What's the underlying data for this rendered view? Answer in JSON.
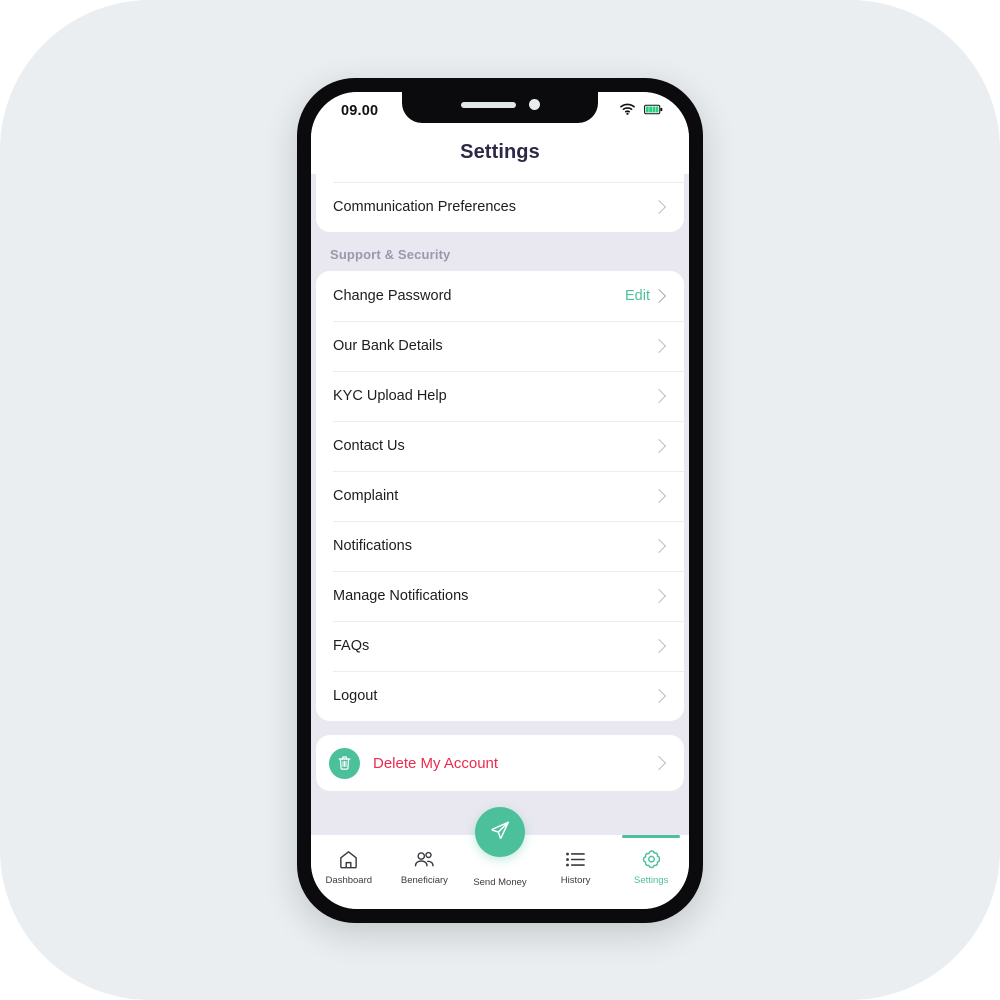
{
  "status_bar": {
    "time": "09.00",
    "wifi_icon": "wifi-icon",
    "battery_icon": "battery-icon"
  },
  "header": {
    "title": "Settings"
  },
  "colors": {
    "accent_green": "#4cbf9b",
    "danger_red": "#ec2b4e",
    "title_purple": "#2e2747",
    "screen_bg": "#e9e8f0",
    "backdrop": "#eaeef0"
  },
  "top_card": {
    "partial_row_label": "",
    "items": [
      {
        "label": "Communication Preferences",
        "chevron": "chevron-right-icon"
      }
    ]
  },
  "section": {
    "title": "Support & Security",
    "items": [
      {
        "label": "Change Password",
        "action": "Edit",
        "chevron": "chevron-right-icon"
      },
      {
        "label": "Our Bank Details",
        "action": "",
        "chevron": "chevron-right-icon"
      },
      {
        "label": "KYC Upload Help",
        "action": "",
        "chevron": "chevron-right-icon"
      },
      {
        "label": "Contact Us",
        "action": "",
        "chevron": "chevron-right-icon"
      },
      {
        "label": "Complaint",
        "action": "",
        "chevron": "chevron-right-icon"
      },
      {
        "label": "Notifications",
        "action": "",
        "chevron": "chevron-right-icon"
      },
      {
        "label": "Manage Notifications",
        "action": "",
        "chevron": "chevron-right-icon"
      },
      {
        "label": "FAQs",
        "action": "",
        "chevron": "chevron-right-icon"
      },
      {
        "label": "Logout",
        "action": "",
        "chevron": "chevron-right-icon"
      }
    ]
  },
  "delete_account": {
    "label": "Delete My Account",
    "icon": "trash-icon",
    "chevron": "chevron-right-icon"
  },
  "bottom_nav": {
    "items": [
      {
        "label": "Dashboard",
        "icon": "home-icon",
        "active": false
      },
      {
        "label": "Beneficiary",
        "icon": "people-icon",
        "active": false
      },
      {
        "label": "Send Money",
        "icon": "paper-plane-icon",
        "active": false,
        "fab": true
      },
      {
        "label": "History",
        "icon": "list-icon",
        "active": false
      },
      {
        "label": "Settings",
        "icon": "gear-icon",
        "active": true
      }
    ]
  }
}
